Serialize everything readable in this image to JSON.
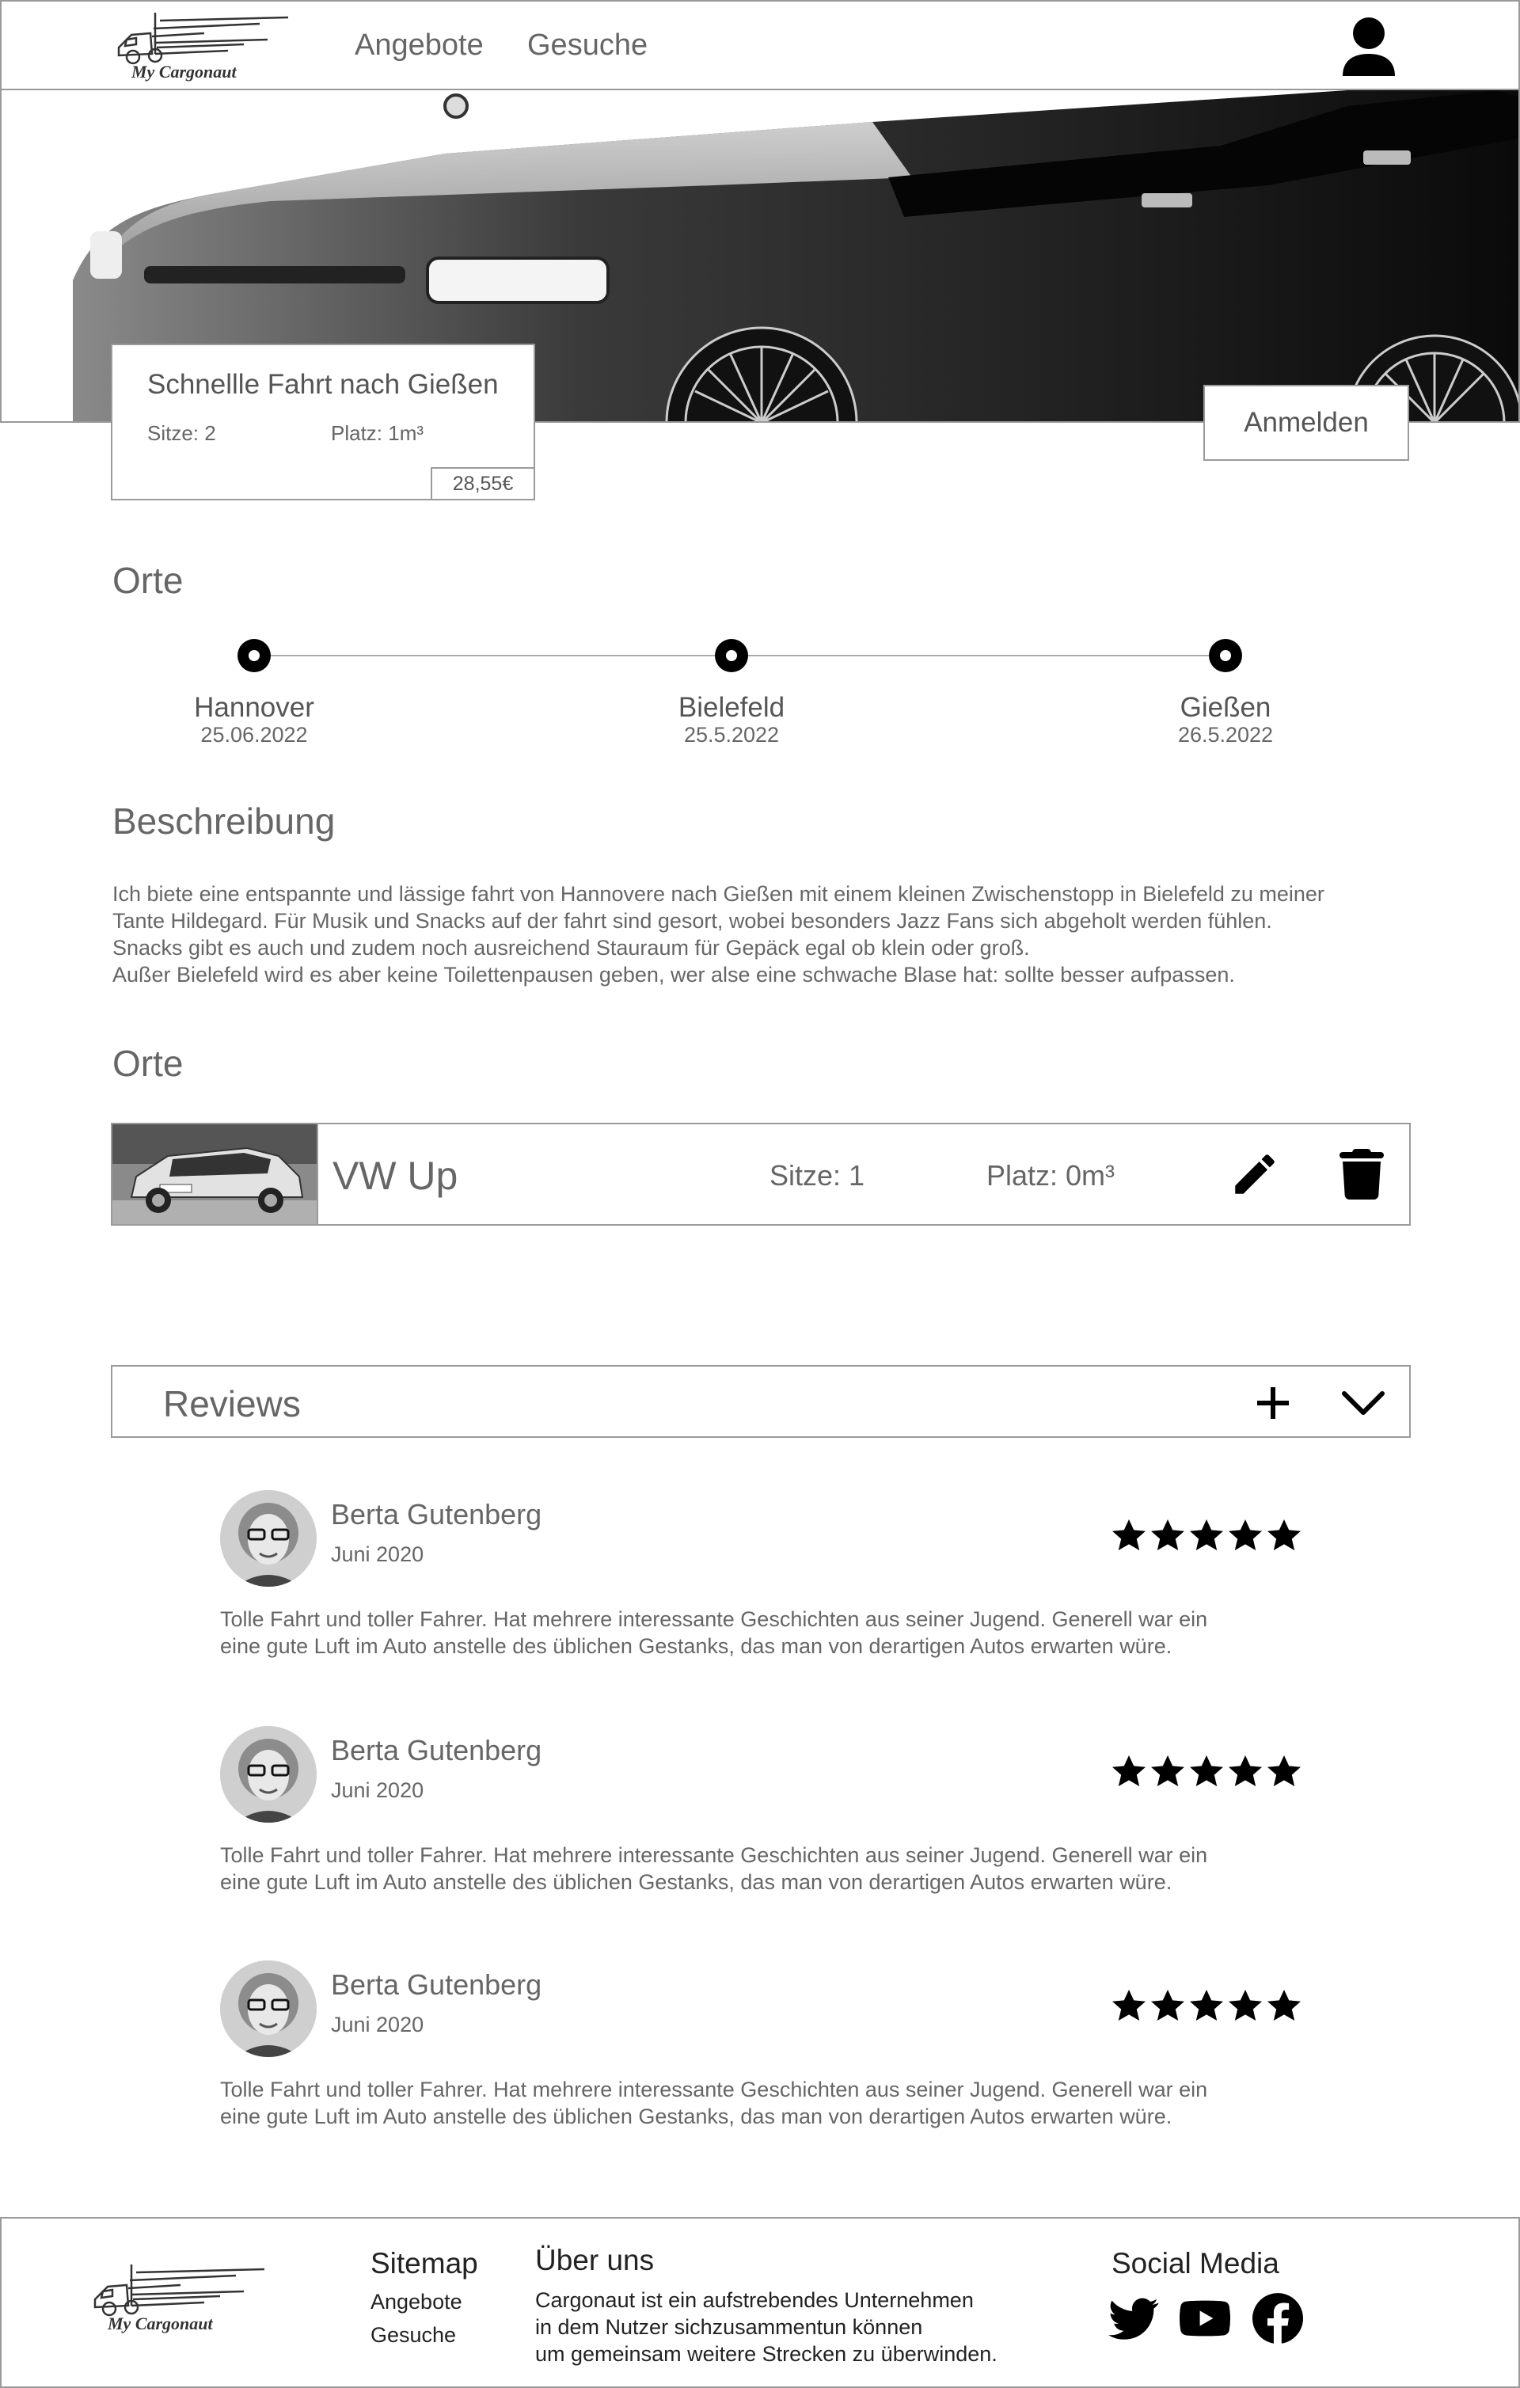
{
  "header": {
    "logo_text": "My Cargonaut",
    "nav": [
      "Angebote",
      "Gesuche"
    ]
  },
  "offer": {
    "title": "Schnellle Fahrt nach Gießen",
    "seats": "Sitze: 2",
    "space": "Platz: 1m³",
    "price": "28,55€"
  },
  "login_button": "Anmelden",
  "route": {
    "heading": "Orte",
    "stops": [
      {
        "name": "Hannover",
        "date": "25.06.2022"
      },
      {
        "name": "Bielefeld",
        "date": "25.5.2022"
      },
      {
        "name": "Gießen",
        "date": "26.5.2022"
      }
    ]
  },
  "description": {
    "heading": "Beschreibung",
    "lines": [
      "Ich biete eine entspannte und lässige fahrt von Hannovere nach Gießen mit einem kleinen Zwischenstopp in Bielefeld zu meiner",
      "Tante Hildegard. Für Musik und Snacks auf der fahrt sind gesort, wobei besonders Jazz Fans sich abgeholt werden fühlen.",
      "Snacks gibt es auch und zudem noch ausreichend Stauraum für Gepäck egal ob klein oder groß.",
      "Außer Bielefeld wird es aber keine Toilettenpausen geben, wer alse eine schwache Blase hat: sollte besser aufpassen."
    ]
  },
  "vehicle": {
    "heading": "Orte",
    "name": "VW Up",
    "seats": "Sitze: 1",
    "space": "Platz: 0m³"
  },
  "reviews": {
    "heading": "Reviews",
    "items": [
      {
        "name": "Berta Gutenberg",
        "date": "Juni 2020",
        "rating": 5,
        "lines": [
          "Tolle Fahrt und toller Fahrer. Hat mehrere interessante Geschichten aus seiner Jugend. Generell war ein",
          "eine gute Luft im Auto anstelle des üblichen Gestanks, das man von derartigen Autos erwarten würe."
        ]
      },
      {
        "name": "Berta Gutenberg",
        "date": "Juni 2020",
        "rating": 5,
        "lines": [
          "Tolle Fahrt und toller Fahrer. Hat mehrere interessante Geschichten aus seiner Jugend. Generell war ein",
          "eine gute Luft im Auto anstelle des üblichen Gestanks, das man von derartigen Autos erwarten würe."
        ]
      },
      {
        "name": "Berta Gutenberg",
        "date": "Juni 2020",
        "rating": 5,
        "lines": [
          "Tolle Fahrt und toller Fahrer. Hat mehrere interessante Geschichten aus seiner Jugend. Generell war ein",
          "eine gute Luft im Auto anstelle des üblichen Gestanks, das man von derartigen Autos erwarten würe."
        ]
      }
    ]
  },
  "footer": {
    "logo_text": "My Cargonaut",
    "sitemap_heading": "Sitemap",
    "sitemap_links": [
      "Angebote",
      "Gesuche"
    ],
    "about_heading": "Über uns",
    "about_lines": [
      "Cargonaut ist ein aufstrebendes Unternehmen",
      "in dem Nutzer sichzusammentun können",
      "um gemeinsam weitere Strecken zu überwinden."
    ],
    "social_heading": "Social Media",
    "social_icons": [
      "twitter-icon",
      "youtube-icon",
      "facebook-icon"
    ]
  }
}
